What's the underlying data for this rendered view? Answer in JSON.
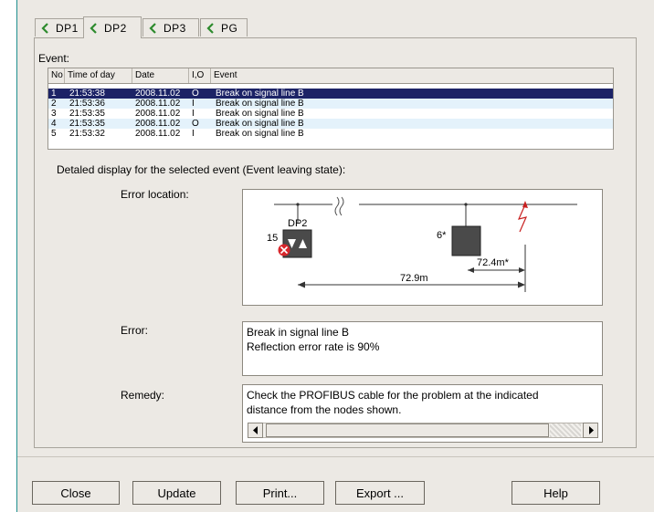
{
  "tabs": [
    {
      "label": "DP1",
      "icon": "chevron-left-icon",
      "active": false
    },
    {
      "label": "DP2",
      "icon": "chevron-left-icon",
      "active": true
    },
    {
      "label": "DP3",
      "icon": "chevron-left-icon",
      "active": false
    },
    {
      "label": "PG",
      "icon": "chevron-left-icon",
      "active": false
    }
  ],
  "event_label": "Event:",
  "table": {
    "columns": [
      "No",
      "Time of day",
      "Date",
      "I,O",
      "Event"
    ],
    "rows": [
      {
        "no": "1",
        "time": "21:53:38",
        "date": "2008.11.02",
        "io": "O",
        "event": "Break on signal line B",
        "selected": true
      },
      {
        "no": "2",
        "time": "21:53:36",
        "date": "2008.11.02",
        "io": "I",
        "event": "Break on signal line B",
        "selected": false
      },
      {
        "no": "3",
        "time": "21:53:35",
        "date": "2008.11.02",
        "io": "I",
        "event": "Break on signal line B",
        "selected": false
      },
      {
        "no": "4",
        "time": "21:53:35",
        "date": "2008.11.02",
        "io": "O",
        "event": "Break on signal line B",
        "selected": false
      },
      {
        "no": "5",
        "time": "21:53:32",
        "date": "2008.11.02",
        "io": "I",
        "event": "Break on signal line B",
        "selected": false
      }
    ]
  },
  "detail_heading": "Detaled display for the selected event (Event leaving state):",
  "error_location_label": "Error location:",
  "diagram": {
    "node_left_name": "DP2",
    "node_left_number": "15",
    "node_right_label": "6*",
    "distance_short": "72.4m*",
    "distance_long": "72.9m",
    "colors": {
      "error_mark": "#d8262b",
      "lightning": "#c82020",
      "node_dark": "#4a4a4a"
    }
  },
  "error_label": "Error:",
  "error_lines": [
    "Break in signal line B",
    "Reflection error rate is 90%"
  ],
  "remedy_label": "Remedy:",
  "remedy_lines": [
    "Check the PROFIBUS cable for the problem at the indicated",
    "distance from the nodes shown."
  ],
  "buttons": {
    "close": "Close",
    "update": "Update",
    "print": "Print...",
    "export": "Export ...",
    "help": "Help"
  }
}
